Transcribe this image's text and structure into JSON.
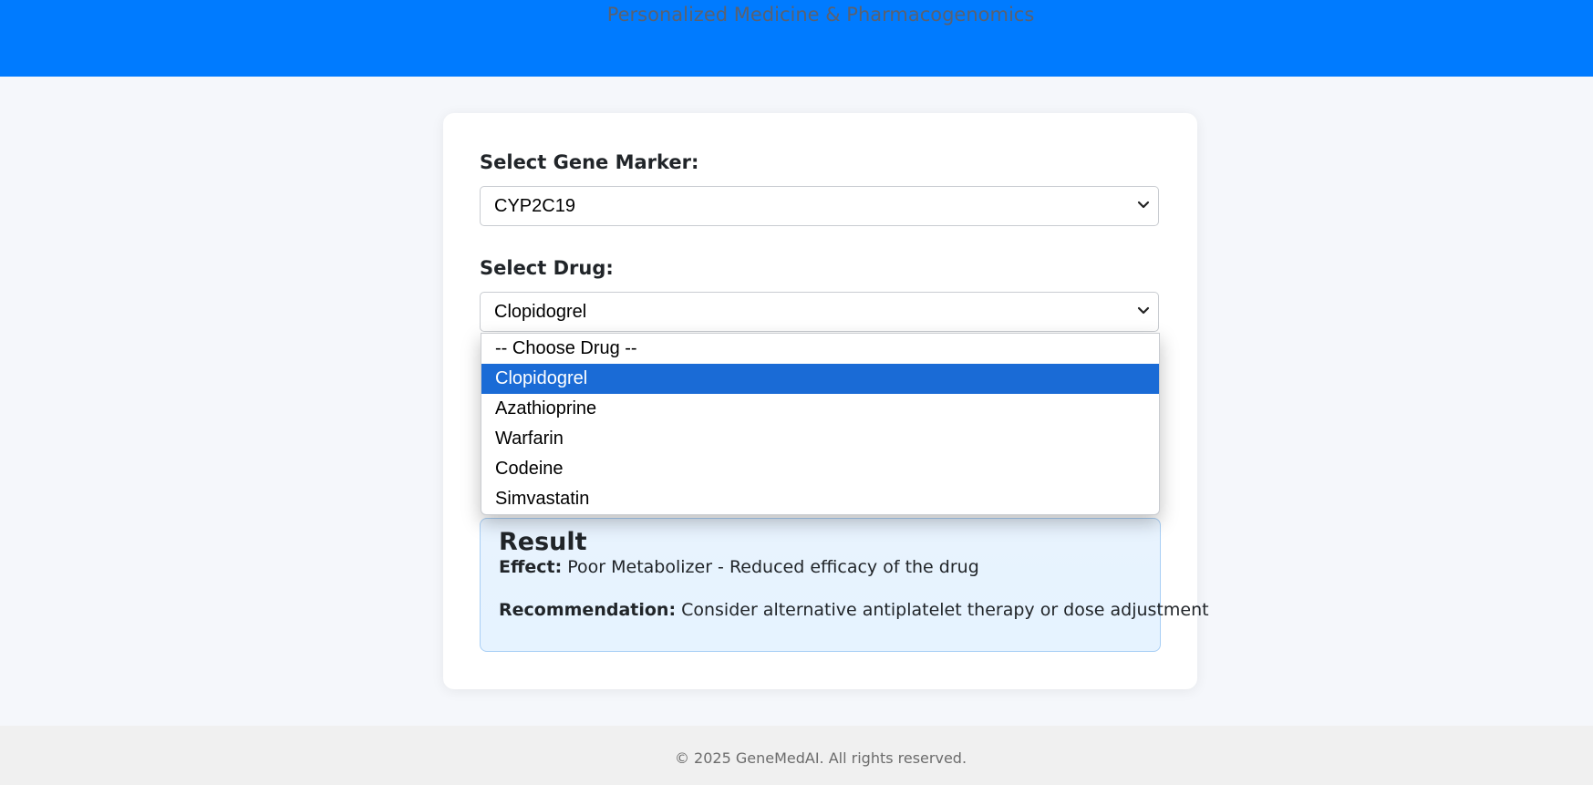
{
  "header": {
    "subtitle": "Personalized Medicine & Pharmacogenomics",
    "color": "#007bff"
  },
  "form": {
    "gene_label": "Select Gene Marker:",
    "gene_value": "CYP2C19",
    "drug_label": "Select Drug:",
    "drug_value": "Clopidogrel",
    "drug_options": [
      "-- Choose Drug --",
      "Clopidogrel",
      "Azathioprine",
      "Warfarin",
      "Codeine",
      "Simvastatin"
    ],
    "selected_option_color": "#1a6bd6"
  },
  "result": {
    "title": "Result",
    "effect_label": "Effect:",
    "effect_value": "Poor Metabolizer - Reduced efficacy of the drug",
    "recommendation_label": "Recommendation:",
    "recommendation_value": "Consider alternative antiplatelet therapy or dose adjustment"
  },
  "footer": {
    "text": "© 2025 GeneMedAI. All rights reserved."
  },
  "icons": {
    "select_chevron": "chevron-down-icon"
  }
}
